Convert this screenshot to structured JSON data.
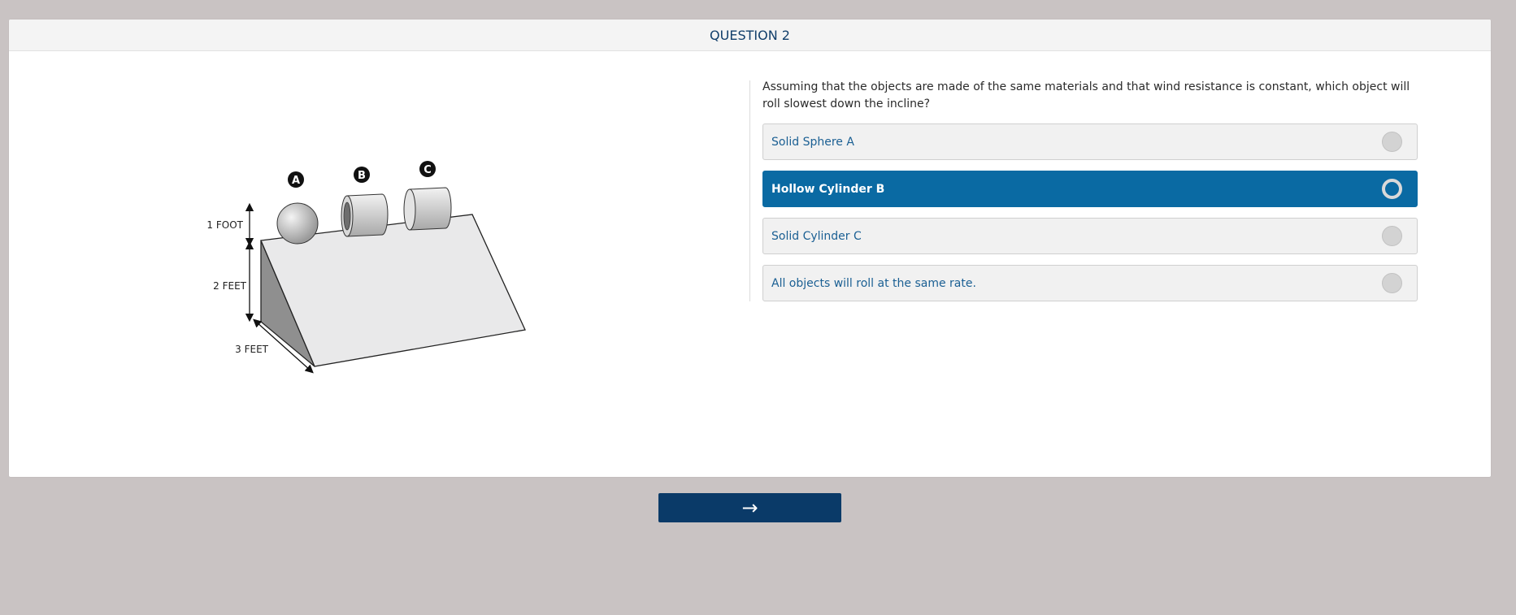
{
  "header": {
    "title": "QUESTION 2"
  },
  "illustration": {
    "labels": {
      "a": "A",
      "b": "B",
      "c": "C"
    },
    "dims": {
      "height1": "1 FOOT",
      "height2": "2 FEET",
      "depth": "3 FEET"
    }
  },
  "question": {
    "text": "Assuming that the objects are made of the same materials and that wind resistance is constant, which object will roll slowest down the incline?"
  },
  "options": [
    {
      "label": "Solid Sphere A",
      "selected": false
    },
    {
      "label": "Hollow Cylinder B",
      "selected": true
    },
    {
      "label": "Solid Cylinder C",
      "selected": false
    },
    {
      "label": "All objects will roll at the same rate.",
      "selected": false
    }
  ],
  "nav": {
    "next_icon": "arrow-right-icon",
    "next_glyph": "→"
  },
  "colors": {
    "background": "#c9c3c3",
    "accent": "#0a6aa3",
    "nav_button": "#0a3a68",
    "title": "#123f6b"
  }
}
